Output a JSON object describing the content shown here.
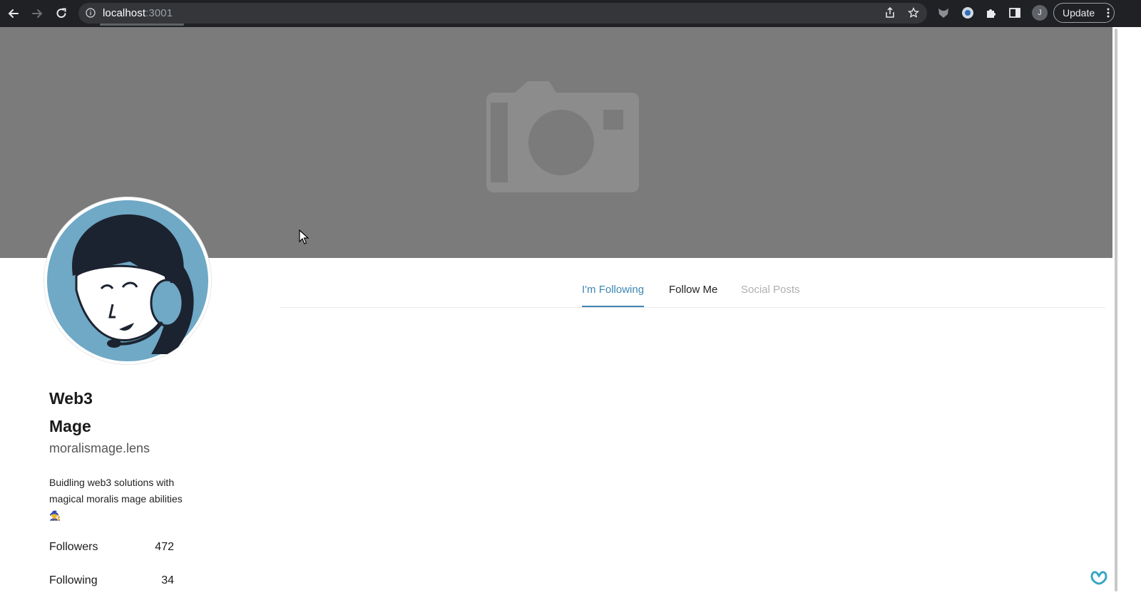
{
  "browser": {
    "url_host": "localhost",
    "url_port": ":3001",
    "profile_initial": "J",
    "update_label": "Update"
  },
  "profile": {
    "name_line1": "Web3",
    "name_line2": "Mage",
    "handle": "moralismage.lens",
    "bio": "Buidling web3 solutions with magical moralis mage abilities",
    "bio_emoji": "🧙"
  },
  "stats": {
    "followers_label": "Followers",
    "followers_value": "472",
    "following_label": "Following",
    "following_value": "34"
  },
  "tabs": [
    {
      "label": "I'm Following",
      "state": "active"
    },
    {
      "label": "Follow Me",
      "state": "normal"
    },
    {
      "label": "Social Posts",
      "state": "disabled"
    }
  ],
  "colors": {
    "accent": "#3d86b4",
    "banner": "#7b7b7b",
    "chrome": "#202124"
  }
}
